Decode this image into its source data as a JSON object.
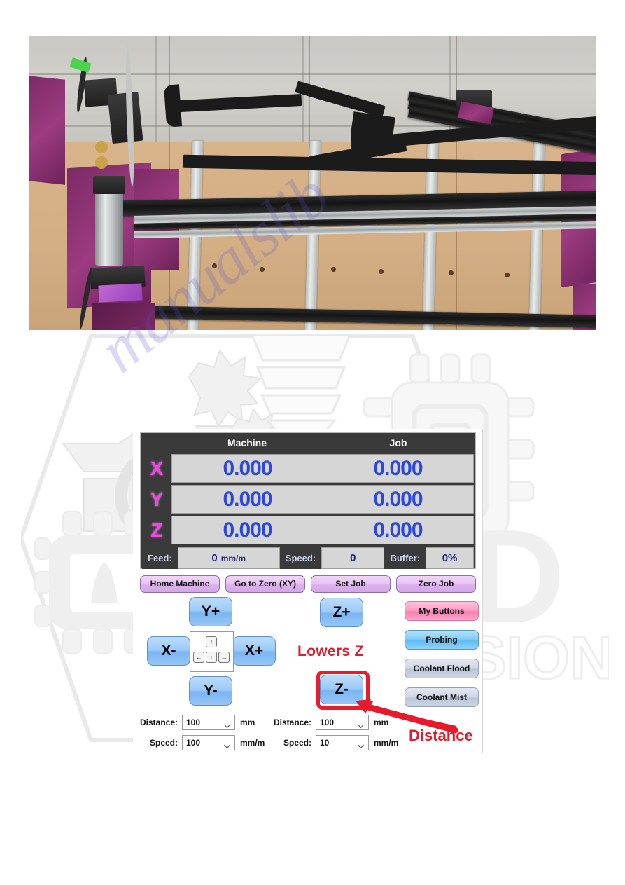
{
  "photo": {
    "alt_name": "cnc-machine-photo",
    "description": "Photo of a purple-framed CNC router machine on a workbench"
  },
  "watermark": {
    "text": "manualslib",
    "color": "#5a52c8"
  },
  "background_logo": {
    "name": "dc-fusion-hexagon-logo",
    "text_large": "D",
    "text_small": "SION"
  },
  "app": {
    "dro": {
      "columns": [
        "Machine",
        "Job"
      ],
      "axes": [
        {
          "label": "X",
          "machine": "0.000",
          "job": "0.000"
        },
        {
          "label": "Y",
          "machine": "0.000",
          "job": "0.000"
        },
        {
          "label": "Z",
          "machine": "0.000",
          "job": "0.000"
        }
      ],
      "status": {
        "feed_label": "Feed:",
        "feed_value": "0",
        "feed_unit": "mm/m",
        "speed_label": "Speed:",
        "speed_value": "0",
        "buffer_label": "Buffer:",
        "buffer_value": "0%"
      },
      "colors": {
        "axis_label": "#ff3df0",
        "value": "#2b47dd",
        "panel_bg": "#3a3a3a",
        "field_bg": "#d6d6d6"
      }
    },
    "top_buttons": [
      {
        "label": "Home Machine",
        "name": "home-machine-button"
      },
      {
        "label": "Go to Zero (XY)",
        "name": "go-to-zero-xy-button"
      },
      {
        "label": "Set Job",
        "name": "set-job-button"
      },
      {
        "label": "Zero Job",
        "name": "zero-job-button"
      }
    ],
    "jog": {
      "y_plus": "Y+",
      "y_minus": "Y-",
      "x_plus": "X+",
      "x_minus": "X-",
      "z_plus": "Z+",
      "z_minus": "Z-",
      "keypad": {
        "up": "↑",
        "down": "↓",
        "left": "←",
        "right": "→"
      }
    },
    "side_buttons": [
      {
        "label": "My Buttons",
        "name": "my-buttons-button",
        "color": "#f77fae"
      },
      {
        "label": "Probing",
        "name": "probing-button",
        "color": "#5fbcf3"
      },
      {
        "label": "Coolant Flood",
        "name": "coolant-flood-button",
        "color": "#bcc5d8"
      },
      {
        "label": "Coolant Mist",
        "name": "coolant-mist-button",
        "color": "#bcc5d8"
      }
    ],
    "xy_controls": {
      "distance_label": "Distance:",
      "distance_value": "100",
      "distance_unit": "mm",
      "speed_label": "Speed:",
      "speed_value": "100",
      "speed_unit": "mm/m"
    },
    "z_controls": {
      "distance_label": "Distance:",
      "distance_value": "100",
      "distance_unit": "mm",
      "speed_label": "Speed:",
      "speed_value": "10",
      "speed_unit": "mm/m"
    }
  },
  "annotations": {
    "lowers_z": "Lowers Z",
    "distance": "Distance",
    "color": "#e8192b"
  }
}
